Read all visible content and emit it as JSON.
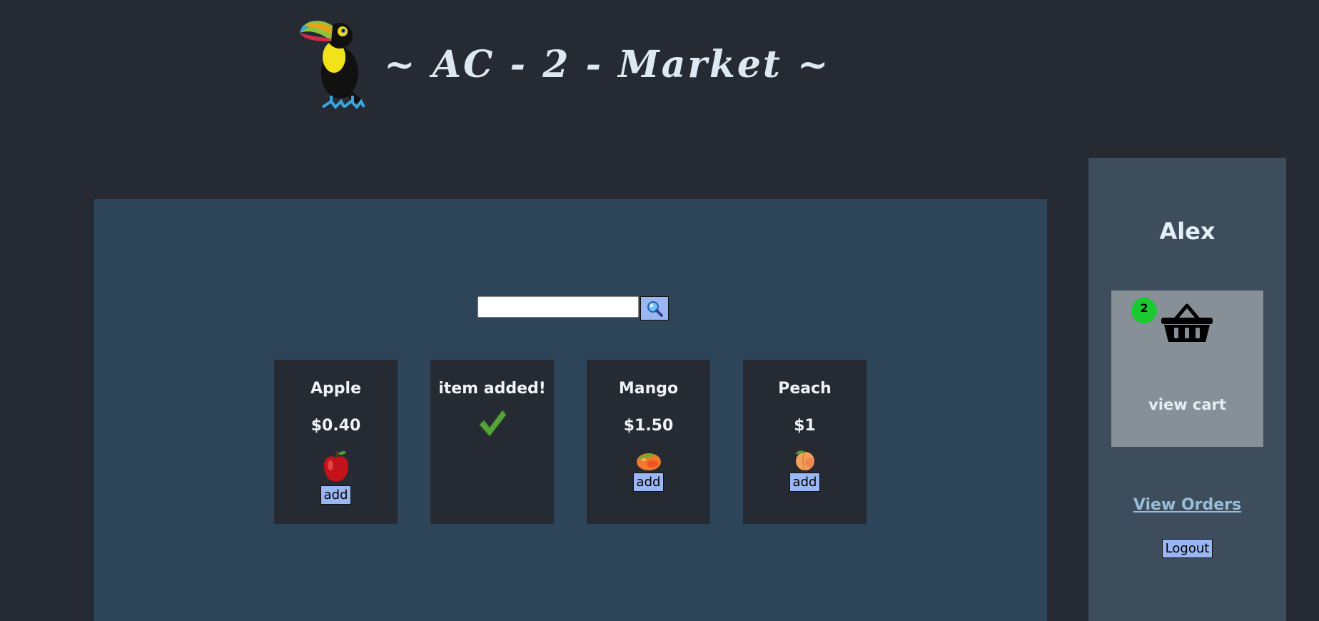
{
  "header": {
    "title": "~ AC - 2 - Market ~"
  },
  "search": {
    "value": "",
    "placeholder": ""
  },
  "products": [
    {
      "name": "Apple",
      "price": "$0.40",
      "icon": "apple-icon",
      "add_label": "add"
    },
    {
      "name": "item added!",
      "icon": "checkmark-icon"
    },
    {
      "name": "Mango",
      "price": "$1.50",
      "icon": "mango-icon",
      "add_label": "add"
    },
    {
      "name": "Peach",
      "price": "$1",
      "icon": "peach-icon",
      "add_label": "add"
    }
  ],
  "sidebar": {
    "user_name": "Alex",
    "cart_count": "2",
    "cart_icon": "basket-icon",
    "view_cart_label": "view cart",
    "view_orders_label": "View Orders",
    "logout_label": "Logout"
  },
  "colors": {
    "background": "#262a33",
    "main_panel": "#2e4458",
    "sidebar": "#3d4d5b",
    "button": "#9ab6f3",
    "badge": "#1bc930",
    "link": "#97bdd9"
  }
}
